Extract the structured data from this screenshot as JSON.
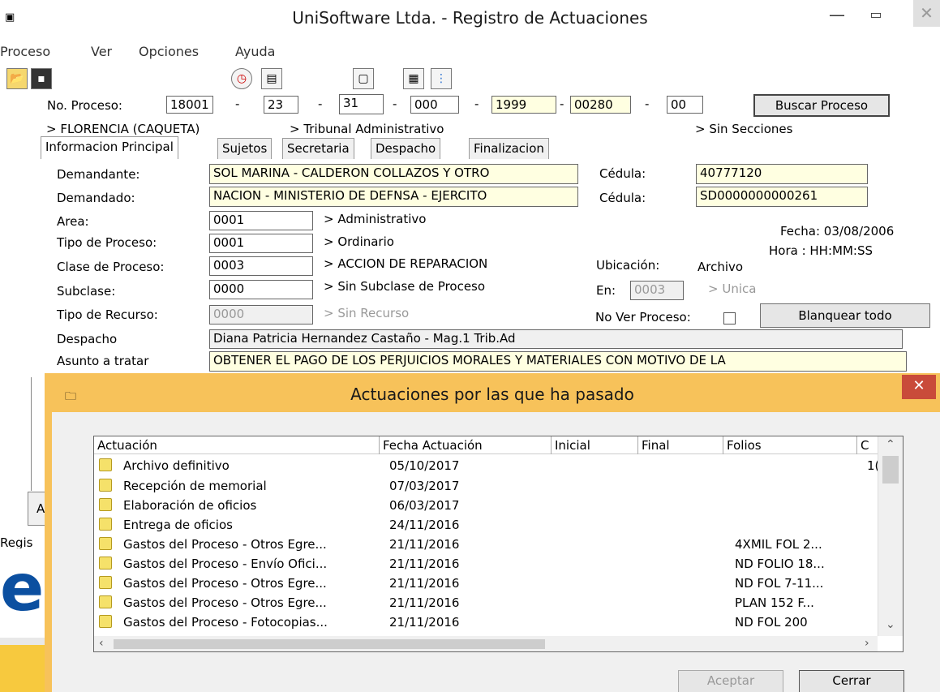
{
  "window": {
    "title": "UniSoftware Ltda. - Registro de Actuaciones",
    "icon": "app-icon"
  },
  "menu": [
    "Proceso",
    "Ver",
    "Opciones",
    "Ayuda"
  ],
  "toolbar_icons": [
    "open-folder-icon",
    "save-icon",
    "clock-icon",
    "document-icon",
    "new-page-icon",
    "calculator-icon",
    "tree-icon"
  ],
  "proceso": {
    "label": "No. Proceso:",
    "parts": [
      "18001",
      "23",
      "31",
      "000",
      "1999",
      "00280",
      "00"
    ],
    "separators": [
      "-",
      "-",
      "-",
      "-",
      "-",
      "-"
    ],
    "search_button": "Buscar Proceso",
    "city": "> FLORENCIA (CAQUETA)",
    "court": "> Tribunal Administrativo",
    "sections": "> Sin Secciones"
  },
  "tabs": [
    "Informacion Principal",
    "Sujetos",
    "Secretaria",
    "Despacho",
    "Finalizacion"
  ],
  "form": {
    "demandante_label": "Demandante:",
    "demandante": "SOL MARINA - CALDERON COLLAZOS Y OTRO",
    "cedula_label": "Cédula:",
    "cedula1": "40777120",
    "demandado_label": "Demandado:",
    "demandado": "NACION - MINISTERIO DE DEFNSA - EJERCITO",
    "cedula2": "SD0000000000261",
    "area_label": "Area:",
    "area_code": "0001",
    "area_desc": "> Administrativo",
    "tipo_label": "Tipo de Proceso:",
    "tipo_code": "0001",
    "tipo_desc": "> Ordinario",
    "clase_label": "Clase de Proceso:",
    "clase_code": "0003",
    "clase_desc": "> ACCION DE REPARACION",
    "subclase_label": "Subclase:",
    "subclase_code": "0000",
    "subclase_desc": "> Sin Subclase de Proceso",
    "recurso_label": "Tipo de Recurso:",
    "recurso_code": "0000",
    "recurso_desc": "> Sin Recurso",
    "fecha": "Fecha: 03/08/2006",
    "hora": "Hora :  HH:MM:SS",
    "ubicacion_label": "Ubicación:",
    "ubicacion": "Archivo",
    "en_label": "En:",
    "en_code": "0003",
    "en_desc": "> Unica",
    "no_ver_label": "No Ver Proceso:",
    "blanquear": "Blanquear todo",
    "despacho_label": "Despacho",
    "despacho": "Diana Patricia Hernandez Castaño - Mag.1 Trib.Ad",
    "asunto_label": "Asunto a tratar",
    "asunto": "OBTENER EL PAGO DE LOS PERJUICIOS MORALES Y MATERIALES CON MOTIVO DE LA"
  },
  "behind": {
    "regis": "Regis",
    "letter": "e",
    "btn": "A"
  },
  "dialog": {
    "title": "Actuaciones por las que ha pasado",
    "columns": [
      "Actuación",
      "Fecha Actuación",
      "Inicial",
      "Final",
      "Folios",
      "C"
    ],
    "rows": [
      [
        "Archivo definitivo",
        "05/10/2017",
        "",
        "",
        "",
        "1("
      ],
      [
        "Recepción de memorial",
        "07/03/2017",
        "",
        "",
        "",
        ""
      ],
      [
        "Elaboración de oficios",
        "06/03/2017",
        "",
        "",
        "",
        ""
      ],
      [
        "Entrega de oficios",
        "24/11/2016",
        "",
        "",
        "",
        ""
      ],
      [
        "Gastos del Proceso - Otros Egre...",
        "21/11/2016",
        "",
        "",
        "4XMIL FOL 2...",
        ""
      ],
      [
        "Gastos del Proceso - Envío Ofici...",
        "21/11/2016",
        "",
        "",
        "ND FOLIO 18...",
        ""
      ],
      [
        "Gastos del Proceso - Otros Egre...",
        "21/11/2016",
        "",
        "",
        "ND FOL 7-11...",
        ""
      ],
      [
        "Gastos del Proceso - Otros Egre...",
        "21/11/2016",
        "",
        "",
        "PLAN 152 F...",
        ""
      ],
      [
        "Gastos del Proceso - Fotocopias...",
        "21/11/2016",
        "",
        "",
        "ND FOL 200",
        ""
      ]
    ],
    "aceptar": "Aceptar",
    "cerrar": "Cerrar"
  }
}
